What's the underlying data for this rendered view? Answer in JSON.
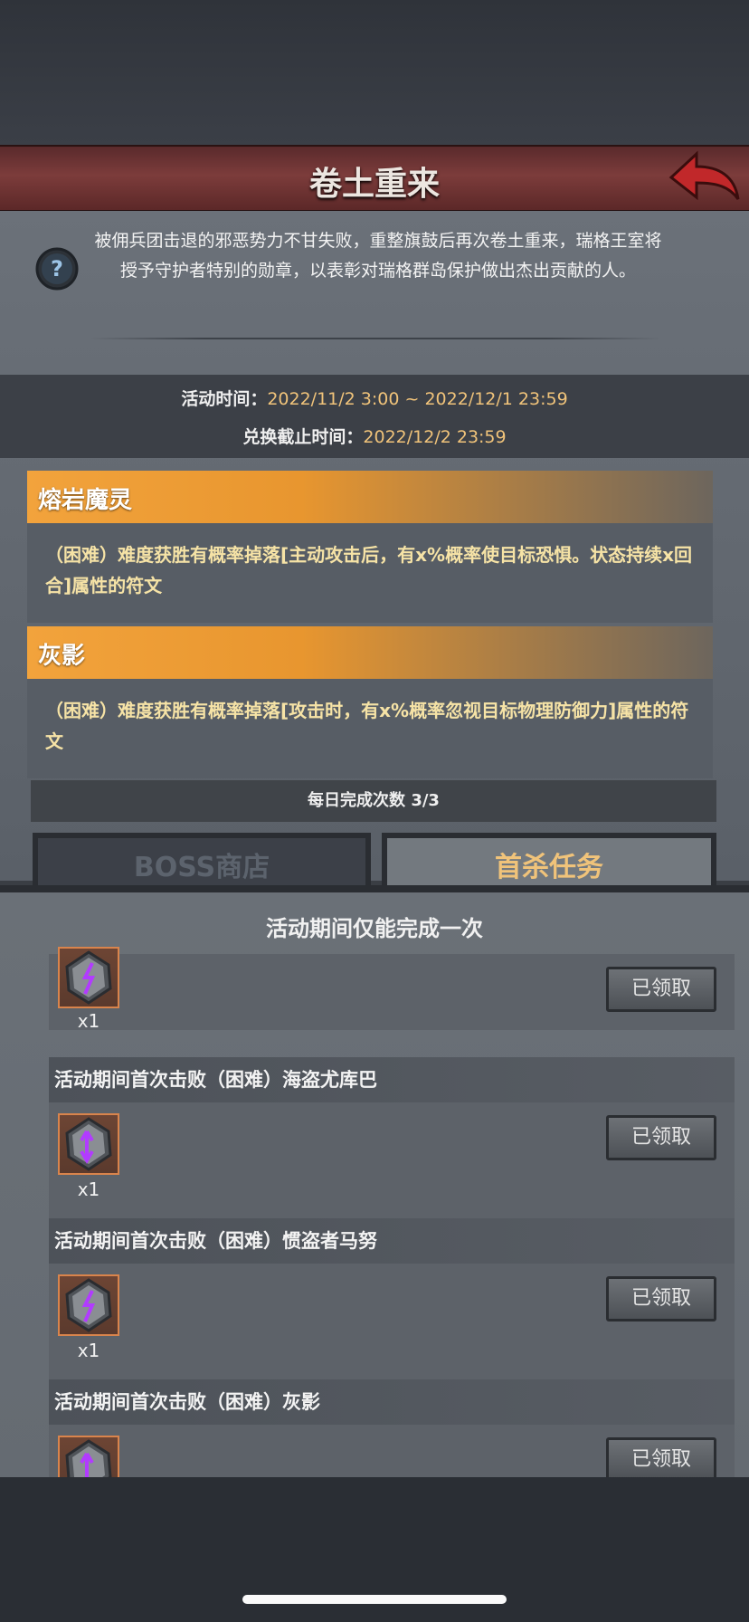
{
  "title": "卷土重来",
  "description": "被佣兵团击退的邪恶势力不甘失败，重整旗鼓后再次卷土重来，瑞格王室将授予守护者特别的勋章，以表彰对瑞格群岛保护做出杰出贡献的人。",
  "activity_time": {
    "label": "活动时间：",
    "value": "2022/11/2 3:00 ~ 2022/12/1 23:59"
  },
  "exchange_deadline": {
    "label": "兑换截止时间：",
    "value": "2022/12/2 23:59"
  },
  "rewards": [
    {
      "name": "熔岩魔灵",
      "text": "（困难）难度获胜有概率掉落[主动攻击后，有x%概率使目标恐惧。状态持续x回合]属性的符文"
    },
    {
      "name": "灰影",
      "text": "（困难）难度获胜有概率掉落[攻击时，有x%概率忽视目标物理防御力]属性的符文"
    }
  ],
  "daily_completion": "每日完成次数  3/3",
  "tabs": {
    "boss_shop": "BOSS商店",
    "first_kill": "首杀任务"
  },
  "list_title": "活动期间仅能完成一次",
  "tasks": [
    {
      "title": "",
      "qty": "x1",
      "button": "已领取"
    },
    {
      "title": "活动期间首次击败（困难）海盗尤库巴",
      "qty": "x1",
      "button": "已领取"
    },
    {
      "title": "活动期间首次击败（困难）惯盗者马努",
      "qty": "x1",
      "button": "已领取"
    },
    {
      "title": "活动期间首次击败（困难）灰影",
      "qty": "",
      "button": "已领取"
    }
  ]
}
